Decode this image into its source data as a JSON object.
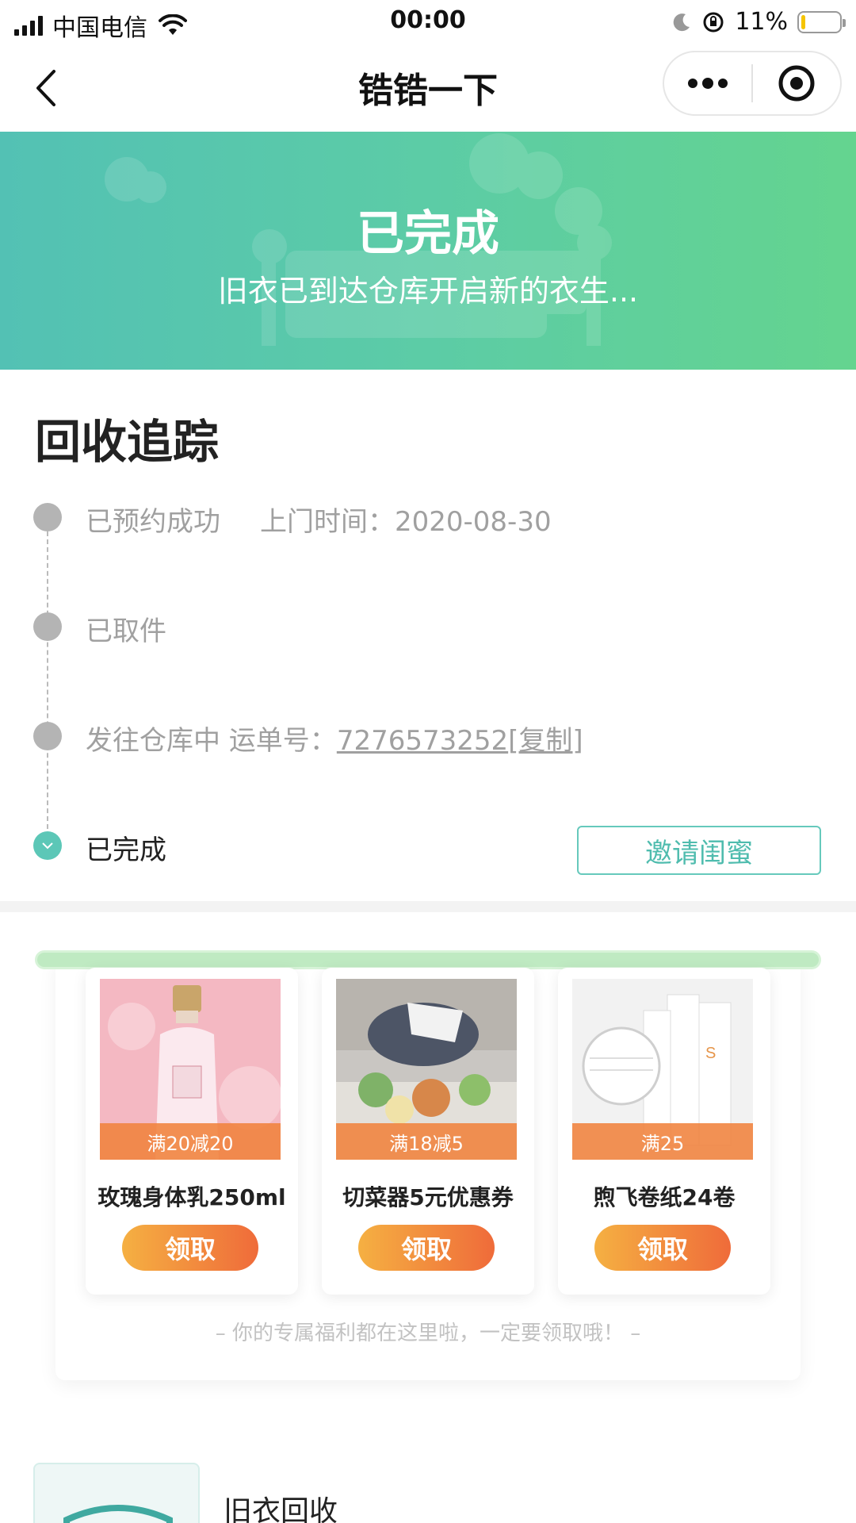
{
  "status_bar": {
    "carrier": "中国电信",
    "time": "00:00",
    "battery_percent": "11%",
    "battery_level": 0.11
  },
  "nav": {
    "title": "锆锆一下",
    "back_icon": "chevron-left-icon",
    "more_icon": "more-dots-icon",
    "close_icon": "target-icon"
  },
  "hero": {
    "title": "已完成",
    "subtitle": "旧衣已到达仓库开启新的衣生..."
  },
  "tracking": {
    "title": "回收追踪",
    "steps": [
      {
        "label": "已预约成功",
        "detail": "上门时间：2020-08-30"
      },
      {
        "label": "已取件"
      },
      {
        "label": "发往仓库中",
        "detail_label": "运单号：",
        "tracking_no": "7276573252",
        "copy": "[复制]"
      },
      {
        "label": "已完成"
      }
    ],
    "invite_button": "邀请闺蜜"
  },
  "coupons": {
    "items": [
      {
        "tag": "满20减20",
        "name": "玫瑰身体乳250ml",
        "button": "领取"
      },
      {
        "tag": "满18减5",
        "name": "切菜器5元优惠券",
        "button": "领取"
      },
      {
        "tag": "满25",
        "name": "煦飞卷纸24卷",
        "button": "领取"
      }
    ],
    "note": "– 你的专属福利都在这里啦，一定要领取哦！ –"
  },
  "bottom": {
    "recycle_label": "旧衣回收"
  },
  "colors": {
    "accent": "#5cc7b7",
    "hero_start": "#53c1b4",
    "hero_end": "#64d48f",
    "coupon_button_start": "#f5b042",
    "coupon_button_end": "#ef6b3a"
  }
}
